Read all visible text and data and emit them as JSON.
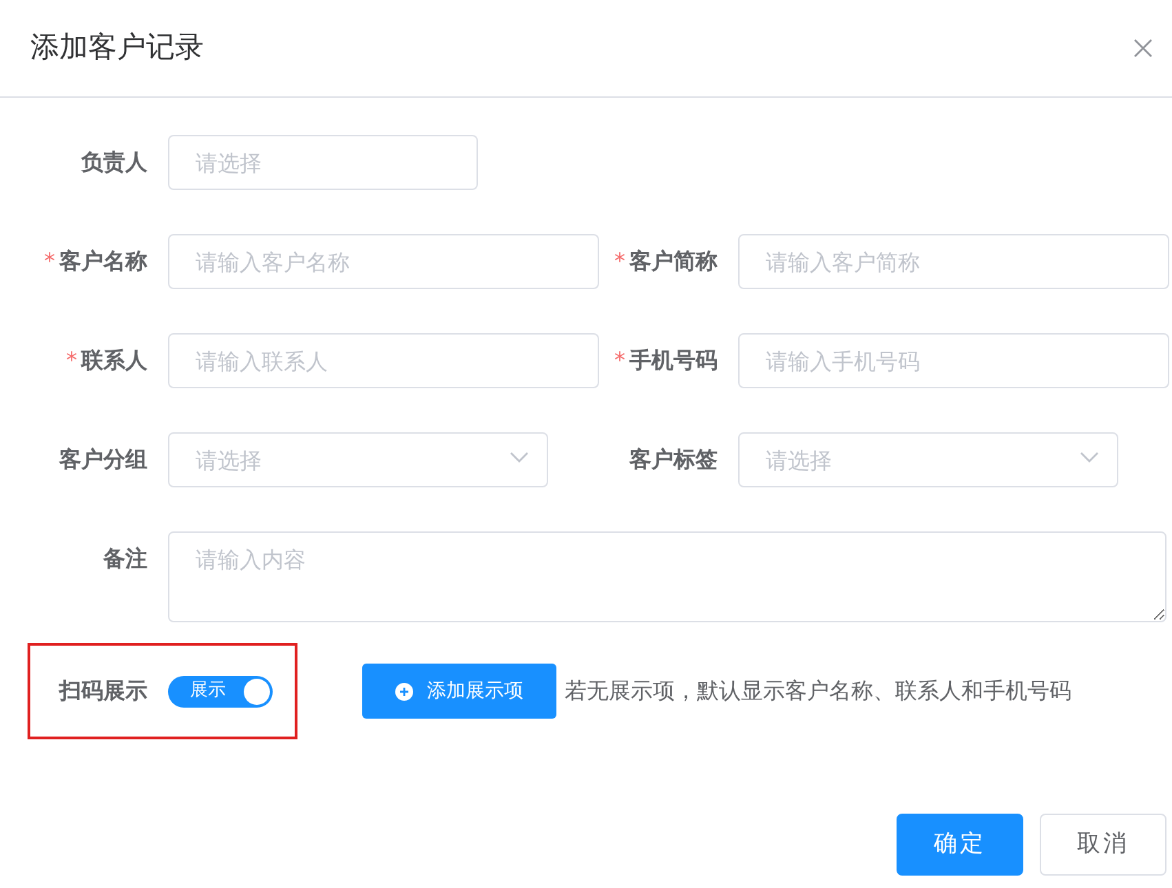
{
  "dialog": {
    "title": "添加客户记录"
  },
  "required_mark": "*",
  "rows": [
    {
      "fields": [
        {
          "label": "负责人",
          "required": false,
          "kind": "input",
          "placeholder": "请选择"
        }
      ]
    },
    {
      "fields": [
        {
          "label": "客户名称",
          "required": true,
          "kind": "input",
          "placeholder": "请输入客户名称"
        },
        {
          "label": "客户简称",
          "required": true,
          "kind": "input",
          "placeholder": "请输入客户简称"
        }
      ]
    },
    {
      "fields": [
        {
          "label": "联系人",
          "required": true,
          "kind": "input",
          "placeholder": "请输入联系人"
        },
        {
          "label": "手机号码",
          "required": true,
          "kind": "input",
          "placeholder": "请输入手机号码"
        }
      ]
    },
    {
      "fields": [
        {
          "label": "客户分组",
          "required": false,
          "kind": "select",
          "placeholder": "请选择"
        },
        {
          "label": "客户标签",
          "required": false,
          "kind": "select",
          "placeholder": "请选择"
        }
      ]
    },
    {
      "fields": [
        {
          "label": "备注",
          "required": false,
          "kind": "textarea",
          "placeholder": "请输入内容"
        }
      ]
    }
  ],
  "scan_display": {
    "label": "扫码展示",
    "highlighted": true,
    "switch": {
      "text": "展示",
      "on": true
    },
    "add_button": "添加展示项",
    "hint": "若无展示项，默认显示客户名称、联系人和手机号码"
  },
  "footer_buttons": [
    {
      "label": "确定",
      "kind": "primary"
    },
    {
      "label": "取消",
      "kind": "default"
    }
  ]
}
